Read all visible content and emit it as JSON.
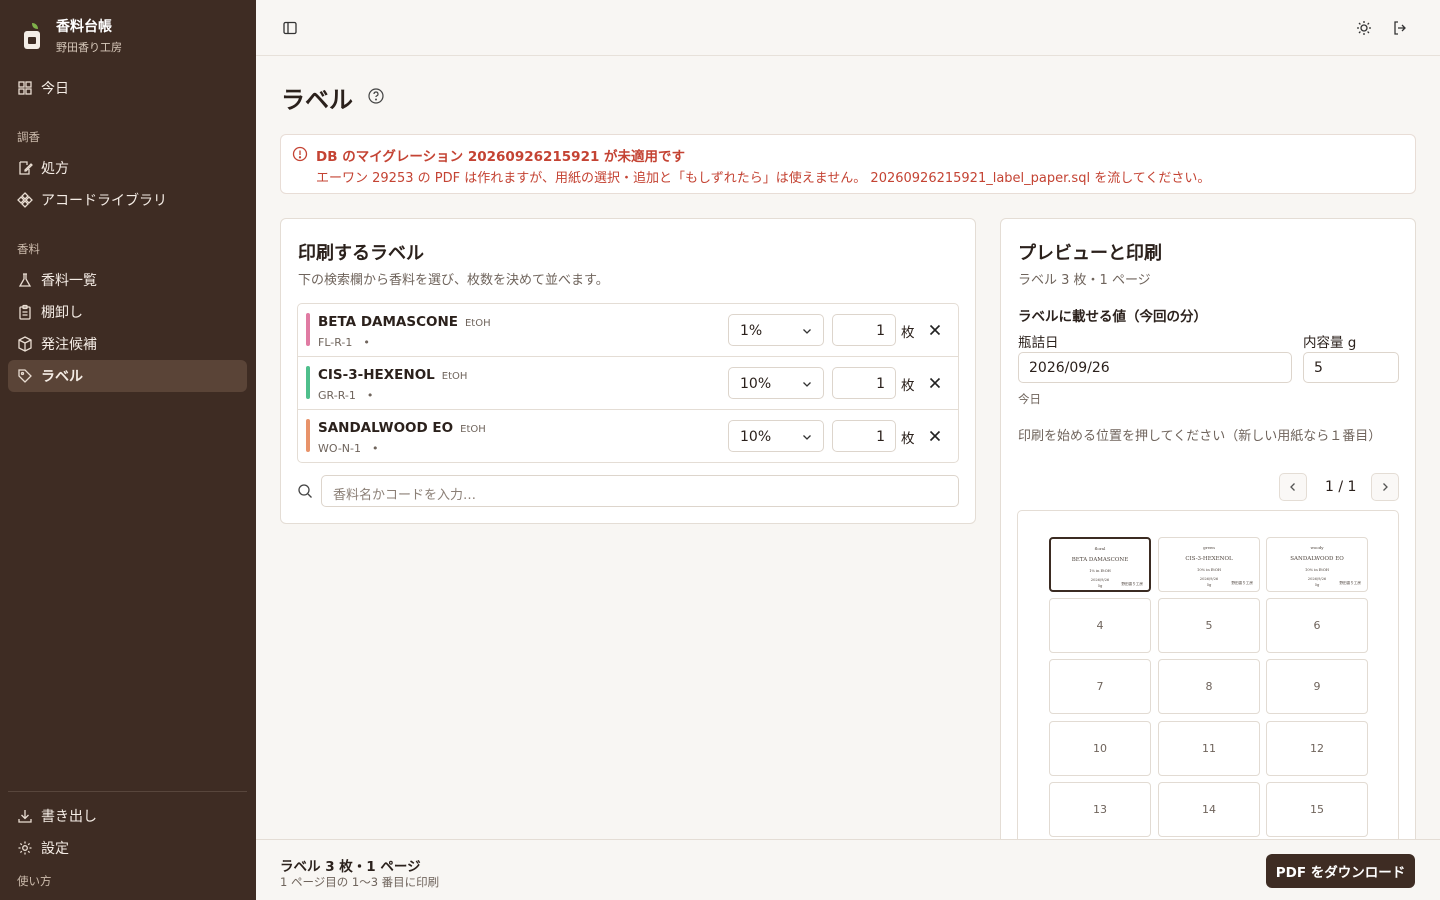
{
  "brand": {
    "title": "香料台帳",
    "subtitle": "野田香り工房"
  },
  "nav": {
    "today": "今日",
    "section_blend": "調香",
    "formula": "処方",
    "accord": "アコードライブラリ",
    "section_fragrance": "香料",
    "fragrance_list": "香料一覧",
    "stocktake": "棚卸し",
    "order": "発注候補",
    "label": "ラベル",
    "export": "書き出し",
    "settings": "設定",
    "howto": "使い方"
  },
  "page": {
    "title": "ラベル"
  },
  "alert": {
    "title": "DB のマイグレーション 20260926215921 が未適用です",
    "body": "エーワン 29253 の PDF は作れますが、用紙の選択・追加と「もしずれたら」は使えません。 20260926215921_label_paper.sql を流してください。"
  },
  "labels_card": {
    "title": "印刷するラベル",
    "desc": "下の検索欄から香料を選び、枚数を決めて並べます。",
    "unit": "枚",
    "search_placeholder": "香料名かコードを入力…",
    "rows": [
      {
        "name": "BETA DAMASCONE",
        "solvent": "EtOH",
        "code": "FL-R-1　•",
        "dilution": "1%",
        "qty": "1",
        "color": "#e07ba3"
      },
      {
        "name": "CIS-3-HEXENOL",
        "solvent": "EtOH",
        "code": "GR-R-1　•",
        "dilution": "10%",
        "qty": "1",
        "color": "#4fbf8c"
      },
      {
        "name": "SANDALWOOD EO",
        "solvent": "EtOH",
        "code": "WO-N-1　•",
        "dilution": "10%",
        "qty": "1",
        "color": "#e8936a"
      }
    ]
  },
  "preview": {
    "title": "プレビューと印刷",
    "sub": "ラベル 3 枚・1 ページ",
    "values_heading": "ラベルに載せる値（今回の分）",
    "date_label": "瓶詰日",
    "date_value": "2026/09/26",
    "date_hint": "今日",
    "volume_label": "内容量 g",
    "volume_value": "5",
    "start_hint": "印刷を始める位置を押してください（新しい用紙なら１番目）",
    "page_indicator": "1 / 1",
    "mini_labels": [
      {
        "family": "floral",
        "name": "BETA DAMASCONE",
        "dil": "1% in EtOH",
        "date": "2026/9/26",
        "vol": "5g",
        "shop": "野田香り工房"
      },
      {
        "family": "green",
        "name": "CIS-3-HEXENOL",
        "dil": "10% in EtOH",
        "date": "2026/9/26",
        "vol": "5g",
        "shop": "野田香り工房"
      },
      {
        "family": "woody",
        "name": "SANDALWOOD EO",
        "dil": "10% in EtOH",
        "date": "2026/9/26",
        "vol": "5g",
        "shop": "野田香り工房"
      }
    ],
    "slots": [
      "4",
      "5",
      "6",
      "7",
      "8",
      "9",
      "10",
      "11",
      "12",
      "13",
      "14",
      "15"
    ]
  },
  "footer": {
    "summary": "ラベル 3 枚・1 ページ",
    "detail": "1 ページ目の 1〜3 番目に印刷",
    "download": "PDF をダウンロード"
  }
}
